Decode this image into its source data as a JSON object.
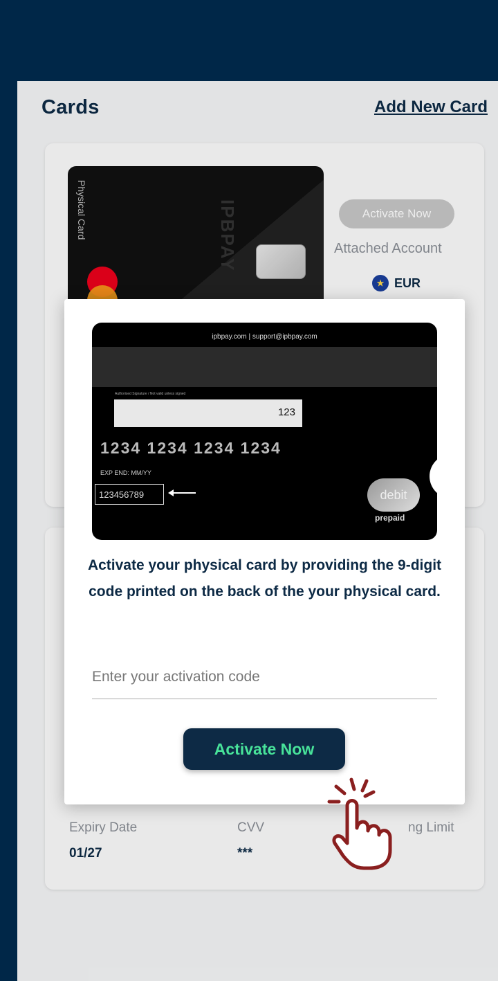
{
  "header": {
    "title": "Cards",
    "add_link": "Add New Card"
  },
  "card_front": {
    "vertical_label": "Physical Card",
    "brand": "IPBPAY"
  },
  "card_panel": {
    "activate_label": "Activate Now",
    "attached_label": "Attached Account",
    "currency": "EUR"
  },
  "details": {
    "expiry_label": "Expiry Date",
    "expiry_value": "01/27",
    "cvv_label": "CVV",
    "cvv_value": "***",
    "limit_label": "ng Limit"
  },
  "modal": {
    "card_back": {
      "top_text": "ipbpay.com  |  support@ipbpay.com",
      "sig_caption": "Authorised Signature / Not valid unless signed",
      "cvv": "123",
      "number": "1234 1234 1234 1234",
      "exp": "EXP END: MM/YY",
      "code": "123456789",
      "debit": "debit",
      "prepaid": "prepaid"
    },
    "message": "Activate your physical card by providing the 9-digit code printed on the back of the your physical card.",
    "input_placeholder": "Enter your activation code",
    "button_label": "Activate Now"
  },
  "colors": {
    "navy": "#0d2a45",
    "accent_green": "#48e39a",
    "background": "#002a4e"
  }
}
